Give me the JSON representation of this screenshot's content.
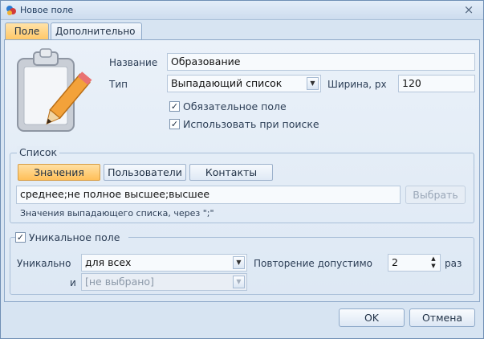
{
  "window": {
    "title": "Новое поле",
    "close_glyph": "×"
  },
  "tabs": [
    {
      "label": "Поле",
      "active": true
    },
    {
      "label": "Дополнительно",
      "active": false
    }
  ],
  "field": {
    "name_label": "Название",
    "name_value": "Образование",
    "type_label": "Тип",
    "type_value": "Выпадающий список",
    "width_label": "Ширина, px",
    "width_value": "120",
    "required_label": "Обязательное поле",
    "required_checked": true,
    "search_label": "Использовать при поиске",
    "search_checked": true,
    "icon": "clipboard-pencil-icon"
  },
  "list": {
    "title": "Список",
    "buttons": [
      {
        "label": "Значения",
        "active": true
      },
      {
        "label": "Пользователи",
        "active": false
      },
      {
        "label": "Контакты",
        "active": false
      }
    ],
    "values_text": "среднее;не полное высшее;высшее",
    "select_button": "Выбрать",
    "hint": "Значения выпадающего списка, через \";\""
  },
  "unique": {
    "title": "Уникальное поле",
    "checked": true,
    "unique_label": "Уникально",
    "unique_value": "для всех",
    "repeat_label": "Повторение допустимо",
    "repeat_value": "2",
    "repeat_unit": "раз",
    "and_label": "и",
    "and_value": "[не выбрано]"
  },
  "footer": {
    "ok": "OK",
    "cancel": "Отмена"
  },
  "colors": {
    "accent": "#ffc766",
    "panel": "#dde8f4",
    "border": "#8ea9c9"
  }
}
